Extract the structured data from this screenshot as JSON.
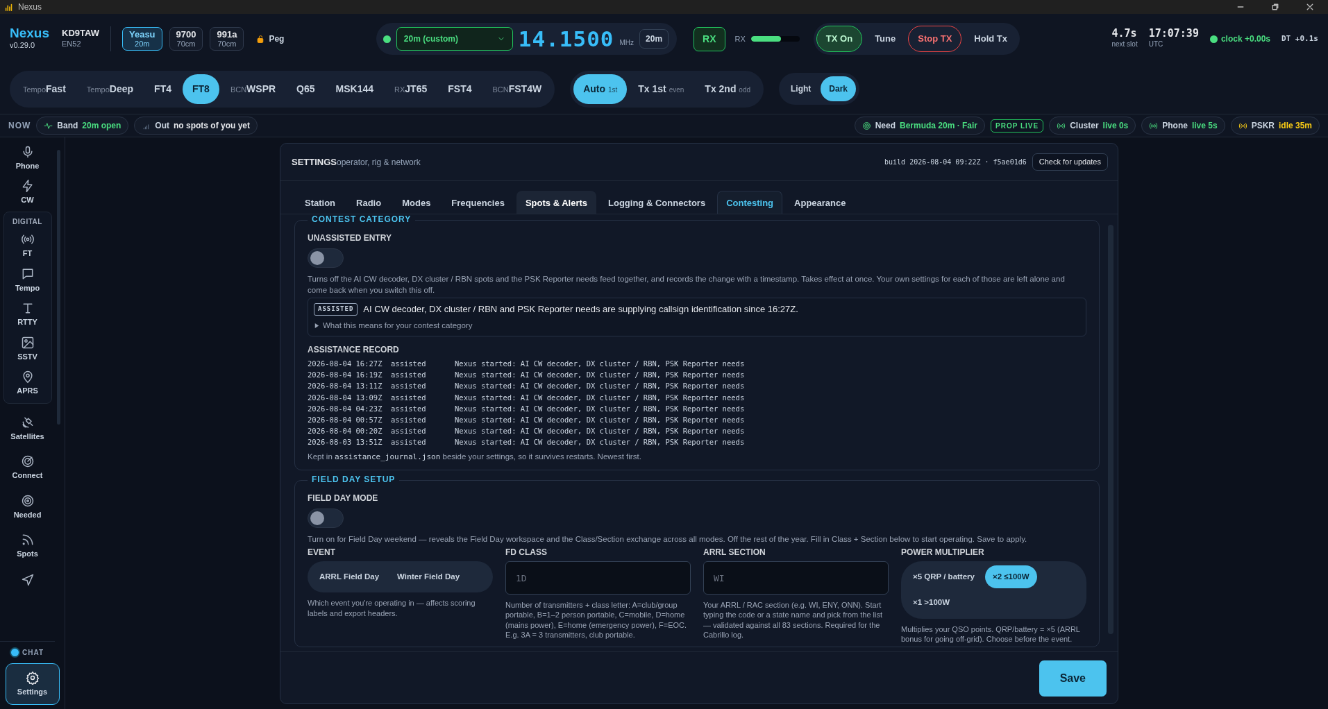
{
  "window": {
    "title": "Nexus"
  },
  "header": {
    "brand": "Nexus",
    "version": "v0.29.0",
    "callsign": "KD9TAW",
    "grid": "EN52",
    "rigs": [
      {
        "name": "Yeasu",
        "band": "20m",
        "selected": true
      },
      {
        "name": "9700",
        "band": "70cm",
        "selected": false
      },
      {
        "name": "991a",
        "band": "70cm",
        "selected": false
      }
    ],
    "peg": "Peg",
    "band_select": "20m (custom)",
    "frequency": "14.1500",
    "unit": "MHz",
    "band": "20m",
    "rx_button": "RX",
    "meter": {
      "label": "RX",
      "level": 0.62
    },
    "tx_controls": [
      {
        "label": "TX On",
        "kind": "active"
      },
      {
        "label": "Tune",
        "kind": "plain"
      },
      {
        "label": "Stop TX",
        "kind": "stop"
      },
      {
        "label": "Hold Tx",
        "kind": "plain"
      }
    ],
    "slot": {
      "value": "4.7s",
      "label": "next slot"
    },
    "clock": {
      "value": "17:07:39",
      "label": "UTC"
    },
    "sync": "clock +0.00s",
    "dt": "DT +0.1s"
  },
  "modes": [
    {
      "prefix": "Tempo",
      "label": "Fast",
      "selected": false
    },
    {
      "prefix": "Tempo",
      "label": "Deep",
      "selected": false
    },
    {
      "label": "FT4",
      "selected": false
    },
    {
      "label": "FT8",
      "selected": true
    },
    {
      "prefix": "BCN",
      "label": "WSPR",
      "selected": false
    },
    {
      "label": "Q65",
      "selected": false
    },
    {
      "label": "MSK144",
      "selected": false
    },
    {
      "prefix": "RX",
      "label": "JT65",
      "selected": false
    },
    {
      "label": "FST4",
      "selected": false
    },
    {
      "prefix": "BCN",
      "label": "FST4W",
      "selected": false
    }
  ],
  "tx_slots": [
    {
      "label": "Auto",
      "hint": "1st",
      "selected": true
    },
    {
      "label": "Tx 1st",
      "hint": "even",
      "selected": false
    },
    {
      "label": "Tx 2nd",
      "hint": "odd",
      "selected": false
    }
  ],
  "theme": [
    {
      "label": "Light",
      "selected": false
    },
    {
      "label": "Dark",
      "selected": true
    }
  ],
  "status_bar": {
    "now": "NOW",
    "left": [
      {
        "label": "Band",
        "value": "20m open",
        "color": "#4ade80"
      },
      {
        "label": "Out",
        "value": "no spots of you yet",
        "color": "#e5e7eb"
      }
    ],
    "need": {
      "label": "Need",
      "value": "Bermuda 20m · Fair"
    },
    "badge": "PROP LIVE",
    "feeds": [
      {
        "label": "Cluster",
        "value": "live 0s",
        "color": "#4ade80"
      },
      {
        "label": "Phone",
        "value": "live 5s",
        "color": "#4ade80"
      },
      {
        "label": "PSKR",
        "value": "idle 35m",
        "color": "#facc15"
      }
    ]
  },
  "sidebar": {
    "items": [
      {
        "kind": "item",
        "label": "Phone",
        "selected": false
      },
      {
        "kind": "item",
        "label": "CW",
        "selected": false
      },
      {
        "kind": "group",
        "label": "DIGITAL",
        "children": [
          {
            "kind": "item",
            "label": "FT",
            "selected": false
          },
          {
            "kind": "item",
            "label": "Tempo",
            "selected": false
          },
          {
            "kind": "item",
            "label": "RTTY",
            "selected": false
          },
          {
            "kind": "item",
            "label": "SSTV",
            "selected": false
          },
          {
            "kind": "item",
            "label": "APRS",
            "selected": false
          }
        ]
      },
      {
        "kind": "item",
        "label": "Satellites",
        "selected": false
      },
      {
        "kind": "item",
        "label": "Connect",
        "selected": false
      },
      {
        "kind": "item",
        "label": "Needed",
        "selected": false
      },
      {
        "kind": "item",
        "label": "Spots",
        "selected": false
      }
    ],
    "chat": "CHAT",
    "settings": {
      "label": "Settings",
      "selected": true
    }
  },
  "settings": {
    "title": "SETTINGS",
    "subtitle": "operator, rig & network",
    "build": "build 2026-08-04 09:22Z · f5ae01d6",
    "update_button": "Check for updates",
    "tabs": [
      {
        "label": "Station",
        "selected": false,
        "hovered": false
      },
      {
        "label": "Radio",
        "selected": false,
        "hovered": false
      },
      {
        "label": "Modes",
        "selected": false,
        "hovered": false
      },
      {
        "label": "Frequencies",
        "selected": false,
        "hovered": false
      },
      {
        "label": "Spots & Alerts",
        "selected": false,
        "hovered": true
      },
      {
        "label": "Logging & Connectors",
        "selected": false,
        "hovered": false
      },
      {
        "label": "Contesting",
        "selected": true,
        "hovered": false
      },
      {
        "label": "Appearance",
        "selected": false,
        "hovered": false
      }
    ],
    "contest": {
      "title": "CONTEST CATEGORY",
      "toggle": {
        "label": "UNASSISTED ENTRY",
        "on": false
      },
      "description": "Turns off the AI CW decoder, DX cluster / RBN spots and the PSK Reporter needs feed together, and records the change with a timestamp. Takes effect at once. Your own settings for each of those are left alone and come back when you switch this off.",
      "notice": {
        "badge": "ASSISTED",
        "text": "AI CW decoder, DX cluster / RBN and PSK Reporter needs are supplying callsign identification since 16:27Z.",
        "details": "What this means for your contest category",
        "expanded": false
      },
      "record": {
        "title": "ASSISTANCE RECORD",
        "rows": [
          {
            "time": "2026-08-04 16:27Z",
            "state": "assisted",
            "event": "Nexus started: AI CW decoder, DX cluster / RBN, PSK Reporter needs"
          },
          {
            "time": "2026-08-04 16:19Z",
            "state": "assisted",
            "event": "Nexus started: AI CW decoder, DX cluster / RBN, PSK Reporter needs"
          },
          {
            "time": "2026-08-04 13:11Z",
            "state": "assisted",
            "event": "Nexus started: AI CW decoder, DX cluster / RBN, PSK Reporter needs"
          },
          {
            "time": "2026-08-04 13:09Z",
            "state": "assisted",
            "event": "Nexus started: AI CW decoder, DX cluster / RBN, PSK Reporter needs"
          },
          {
            "time": "2026-08-04 04:23Z",
            "state": "assisted",
            "event": "Nexus started: AI CW decoder, DX cluster / RBN, PSK Reporter needs"
          },
          {
            "time": "2026-08-04 00:57Z",
            "state": "assisted",
            "event": "Nexus started: AI CW decoder, DX cluster / RBN, PSK Reporter needs"
          },
          {
            "time": "2026-08-04 00:20Z",
            "state": "assisted",
            "event": "Nexus started: AI CW decoder, DX cluster / RBN, PSK Reporter needs"
          },
          {
            "time": "2026-08-03 13:51Z",
            "state": "assisted",
            "event": "Nexus started: AI CW decoder, DX cluster / RBN, PSK Reporter needs"
          }
        ],
        "footnote": {
          "before": "Kept in",
          "file": "assistance_journal.json",
          "after": "beside your settings, so it survives restarts. Newest first."
        }
      }
    },
    "field_day": {
      "title": "FIELD DAY SETUP",
      "toggle": {
        "label": "FIELD DAY MODE",
        "on": false
      },
      "description": "Turn on for Field Day weekend — reveals the Field Day workspace and the Class/Section exchange across all modes. Off the rest of the year. Fill in Class + Section below to start operating. Save to apply.",
      "event": {
        "label": "EVENT",
        "options": [
          {
            "label": "ARRL Field Day",
            "selected": false
          },
          {
            "label": "Winter Field Day",
            "selected": false
          }
        ],
        "help": "Which event you're operating in — affects scoring labels and export headers."
      },
      "fd_class": {
        "label": "FD CLASS",
        "placeholder": "1D",
        "help": "Number of transmitters + class letter: A=club/group portable, B=1–2 person portable, C=mobile, D=home (mains power), E=home (emergency power), F=EOC. E.g. 3A = 3 transmitters, club portable."
      },
      "section": {
        "label": "ARRL SECTION",
        "placeholder": "WI",
        "help": "Your ARRL / RAC section (e.g. WI, ENY, ONN). Start typing the code or a state name and pick from the list — validated against all 83 sections. Required for the Cabrillo log."
      },
      "power": {
        "label": "POWER MULTIPLIER",
        "options": [
          {
            "label": "×5 QRP / battery",
            "selected": false
          },
          {
            "label": "×2 ≤100W",
            "selected": true
          },
          {
            "label": "×1 >100W",
            "selected": false
          }
        ],
        "help": "Multiplies your QSO points. QRP/battery = ×5 (ARRL bonus for going off-grid). Choose before the event."
      }
    },
    "save": "Save"
  }
}
